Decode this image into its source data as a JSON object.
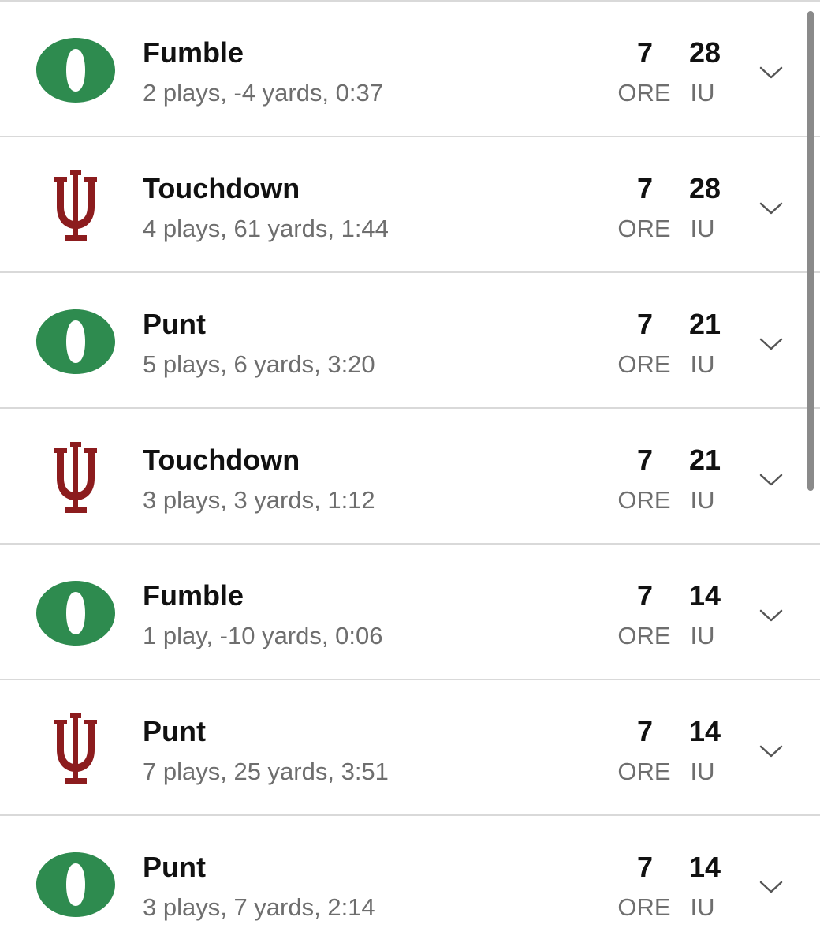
{
  "colors": {
    "oregon_green": "#2e8b4f",
    "indiana_crimson": "#8c1c1e",
    "divider": "#d9d9d9",
    "secondary_text": "#6e6e6e"
  },
  "drives": [
    {
      "team": "ORE",
      "logo": "oregon-o-logo",
      "result": "Fumble",
      "summary": "2 plays, -4 yards, 0:37",
      "away_score": "7",
      "home_score": "28",
      "away_abbr": "ORE",
      "home_abbr": "IU"
    },
    {
      "team": "IU",
      "logo": "indiana-trident-logo",
      "result": "Touchdown",
      "summary": "4 plays, 61 yards, 1:44",
      "away_score": "7",
      "home_score": "28",
      "away_abbr": "ORE",
      "home_abbr": "IU"
    },
    {
      "team": "ORE",
      "logo": "oregon-o-logo",
      "result": "Punt",
      "summary": "5 plays, 6 yards, 3:20",
      "away_score": "7",
      "home_score": "21",
      "away_abbr": "ORE",
      "home_abbr": "IU"
    },
    {
      "team": "IU",
      "logo": "indiana-trident-logo",
      "result": "Touchdown",
      "summary": "3 plays, 3 yards, 1:12",
      "away_score": "7",
      "home_score": "21",
      "away_abbr": "ORE",
      "home_abbr": "IU"
    },
    {
      "team": "ORE",
      "logo": "oregon-o-logo",
      "result": "Fumble",
      "summary": "1 play, -10 yards, 0:06",
      "away_score": "7",
      "home_score": "14",
      "away_abbr": "ORE",
      "home_abbr": "IU"
    },
    {
      "team": "IU",
      "logo": "indiana-trident-logo",
      "result": "Punt",
      "summary": "7 plays, 25 yards, 3:51",
      "away_score": "7",
      "home_score": "14",
      "away_abbr": "ORE",
      "home_abbr": "IU"
    },
    {
      "team": "ORE",
      "logo": "oregon-o-logo",
      "result": "Punt",
      "summary": "3 plays, 7 yards, 2:14",
      "away_score": "7",
      "home_score": "14",
      "away_abbr": "ORE",
      "home_abbr": "IU"
    }
  ]
}
